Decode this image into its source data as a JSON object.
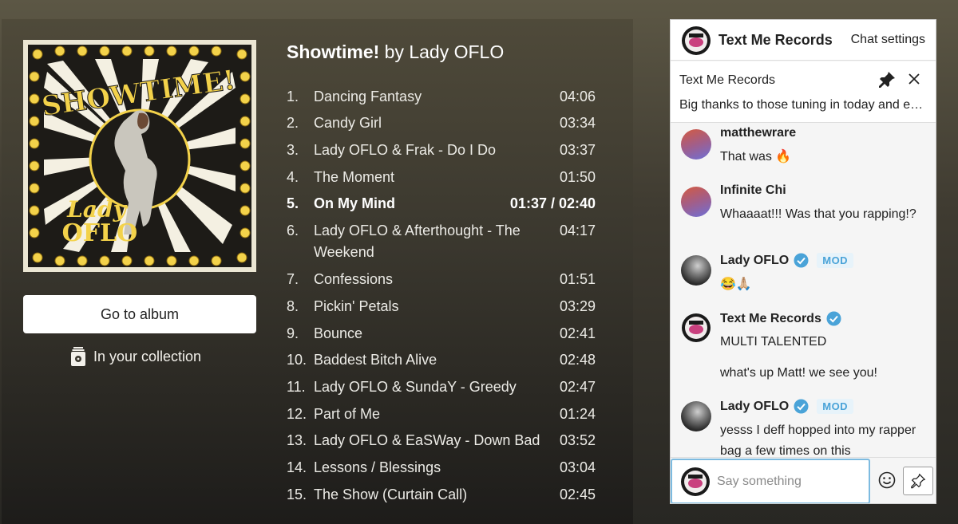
{
  "album": {
    "title": "Showtime!",
    "by_text": "by Lady OFLO",
    "art_title": "SHOWTIME!",
    "art_artist_line1": "Lady",
    "art_artist_line2": "OFLO",
    "go_to_album_label": "Go to album",
    "collection_label": "In your collection"
  },
  "tracks": [
    {
      "num": "1.",
      "name": "Dancing Fantasy",
      "duration": "04:06"
    },
    {
      "num": "2.",
      "name": "Candy Girl",
      "duration": "03:34"
    },
    {
      "num": "3.",
      "name": "Lady OFLO & Frak - Do I Do",
      "duration": "03:37"
    },
    {
      "num": "4.",
      "name": "The Moment",
      "duration": "01:50"
    },
    {
      "num": "5.",
      "name": "On My Mind",
      "duration": "01:37 / 02:40",
      "current": true
    },
    {
      "num": "6.",
      "name": "Lady OFLO & Afterthought - The Weekend",
      "duration": "04:17"
    },
    {
      "num": "7.",
      "name": "Confessions",
      "duration": "01:51"
    },
    {
      "num": "8.",
      "name": "Pickin' Petals",
      "duration": "03:29"
    },
    {
      "num": "9.",
      "name": "Bounce",
      "duration": "02:41"
    },
    {
      "num": "10.",
      "name": "Baddest Bitch Alive",
      "duration": "02:48"
    },
    {
      "num": "11.",
      "name": "Lady OFLO & SundaY - Greedy",
      "duration": "02:47"
    },
    {
      "num": "12.",
      "name": "Part of Me",
      "duration": "01:24"
    },
    {
      "num": "13.",
      "name": "Lady OFLO & EaSWay - Down Bad",
      "duration": "03:52"
    },
    {
      "num": "14.",
      "name": "Lessons / Blessings",
      "duration": "03:04"
    },
    {
      "num": "15.",
      "name": "The Show (Curtain Call)",
      "duration": "02:45"
    }
  ],
  "chat": {
    "title": "Text Me Records",
    "settings_label": "Chat settings",
    "pinned": {
      "title": "Text Me Records",
      "text": "Big thanks to those tuning in today and everyone who made it out"
    },
    "messages": [
      {
        "user": "matthewrare",
        "text": "That was 🔥"
      },
      {
        "user": "Infinite Chi",
        "text": "Whaaaat!!! Was that you rapping!?"
      },
      {
        "user": "Lady OFLO",
        "badge": "MOD",
        "text": "😂🙏🏼"
      },
      {
        "user": "Text Me Records",
        "text": "MULTI TALENTED",
        "text2": "what's up Matt! we see you!"
      },
      {
        "user": "Lady OFLO",
        "badge": "MOD",
        "text": "yesss I deff hopped into my rapper bag a few times on this"
      }
    ],
    "composer_placeholder": "Say something"
  },
  "icons": {
    "collection": "collection-icon",
    "pin": "pin-icon",
    "close": "close-icon",
    "emoji": "emoji-icon",
    "verified": "verified-check-icon"
  },
  "colors": {
    "accent_blue": "#4aa3d8",
    "mod_badge_bg": "#e7f3fa",
    "input_focus": "#7dbbe0"
  }
}
